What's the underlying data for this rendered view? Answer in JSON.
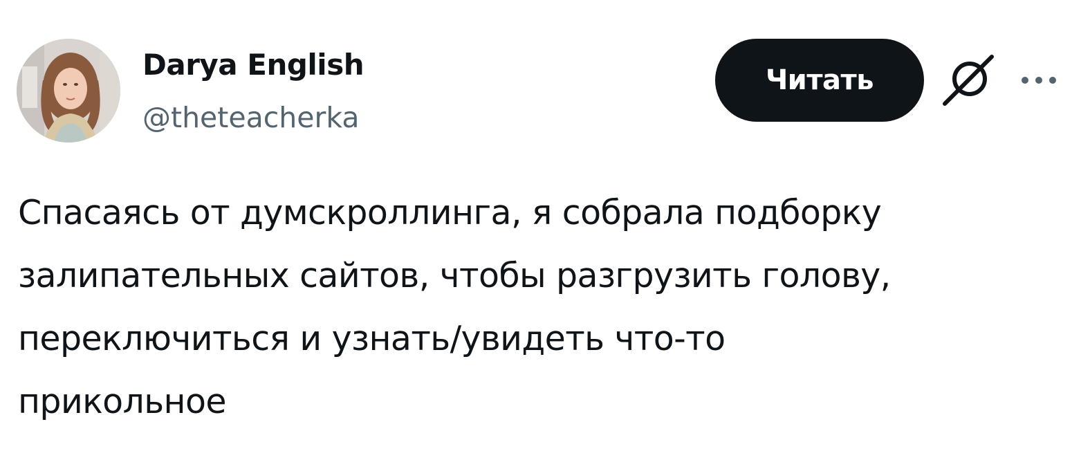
{
  "author": {
    "display_name": "Darya English",
    "handle": "@theteacherka"
  },
  "actions": {
    "follow_label": "Читать",
    "grok_icon": "grok-icon",
    "more_icon": "more-horizontal-icon"
  },
  "tweet": {
    "text": "Спасаясь от думскроллинга, я собрала подборку\nзалипательных сайтов, чтобы разгрузить голову,\nпереключиться и узнать/увидеть что-то\nприкольное"
  },
  "colors": {
    "text_primary": "#0f1419",
    "text_secondary": "#536471",
    "button_bg": "#0f1419",
    "button_text": "#ffffff"
  }
}
